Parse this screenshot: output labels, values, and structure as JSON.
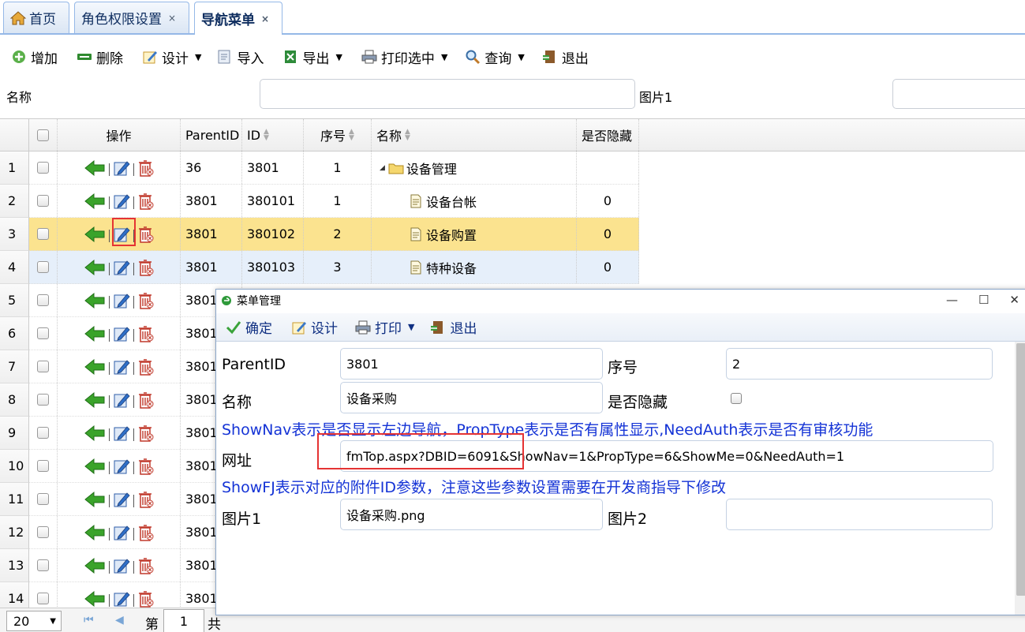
{
  "tabs": [
    {
      "label": "首页",
      "icon": "home-icon",
      "closable": false,
      "active": false
    },
    {
      "label": "角色权限设置",
      "closable": true,
      "active": false
    },
    {
      "label": "导航菜单",
      "closable": true,
      "active": true
    }
  ],
  "tab_close_glyph": "×",
  "toolbar": {
    "add": "增加",
    "delete": "删除",
    "design": "设计",
    "import": "导入",
    "export": "导出",
    "print_selected": "打印选中",
    "query": "查询",
    "exit": "退出"
  },
  "filter": {
    "name_label": "名称",
    "image_label": "图片1",
    "name_value": "",
    "image_value": ""
  },
  "grid": {
    "headers": {
      "ops": "操作",
      "parentid": "ParentID",
      "id": "ID",
      "seq": "序号",
      "name": "名称",
      "hidden": "是否隐藏"
    },
    "rows": [
      {
        "n": "1",
        "parentid": "36",
        "id": "3801",
        "seq": "1",
        "name": "设备管理",
        "hidden": "",
        "type": "folder"
      },
      {
        "n": "2",
        "parentid": "3801",
        "id": "380101",
        "seq": "1",
        "name": "设备台帐",
        "hidden": "0",
        "type": "file"
      },
      {
        "n": "3",
        "parentid": "3801",
        "id": "380102",
        "seq": "2",
        "name": "设备购置",
        "hidden": "0",
        "type": "file"
      },
      {
        "n": "4",
        "parentid": "3801",
        "id": "380103",
        "seq": "3",
        "name": "特种设备",
        "hidden": "0",
        "type": "file"
      },
      {
        "n": "5",
        "parentid": "3801"
      },
      {
        "n": "6",
        "parentid": "3801"
      },
      {
        "n": "7",
        "parentid": "3801"
      },
      {
        "n": "8",
        "parentid": "3801"
      },
      {
        "n": "9",
        "parentid": "3801"
      },
      {
        "n": "10",
        "parentid": "3801"
      },
      {
        "n": "11",
        "parentid": "3801"
      },
      {
        "n": "12",
        "parentid": "3801"
      },
      {
        "n": "13",
        "parentid": "3801"
      },
      {
        "n": "14",
        "parentid": "3801"
      }
    ]
  },
  "pager": {
    "page_size": "20",
    "page_prefix": "第",
    "page_number": "1",
    "page_suffix": "共"
  },
  "dialog": {
    "title": "菜单管理",
    "toolbar": {
      "ok": "确定",
      "design": "设计",
      "print": "打印",
      "exit": "退出"
    },
    "fields": {
      "parentid_label": "ParentID",
      "parentid_value": "3801",
      "seq_label": "序号",
      "seq_value": "2",
      "name_label": "名称",
      "name_value": "设备采购",
      "hidden_label": "是否隐藏",
      "url_label": "网址",
      "url_value": "fmTop.aspx?DBID=6091&ShowNav=1&PropType=6&ShowMe=0&NeedAuth=1",
      "img1_label": "图片1",
      "img1_value": "设备采购.png",
      "img2_label": "图片2",
      "img2_value": ""
    },
    "note1": "ShowNav表示是否显示左边导航，PropType表示是否有属性显示,NeedAuth表示是否有审核功能",
    "note2": "ShowFJ表示对应的附件ID参数，注意这些参数设置需要在开发商指导下修改"
  },
  "colors": {
    "accent": "#95b8e7",
    "selected_row": "#fbe38f",
    "note_text": "#1433d6",
    "highlight": "#e53333"
  }
}
